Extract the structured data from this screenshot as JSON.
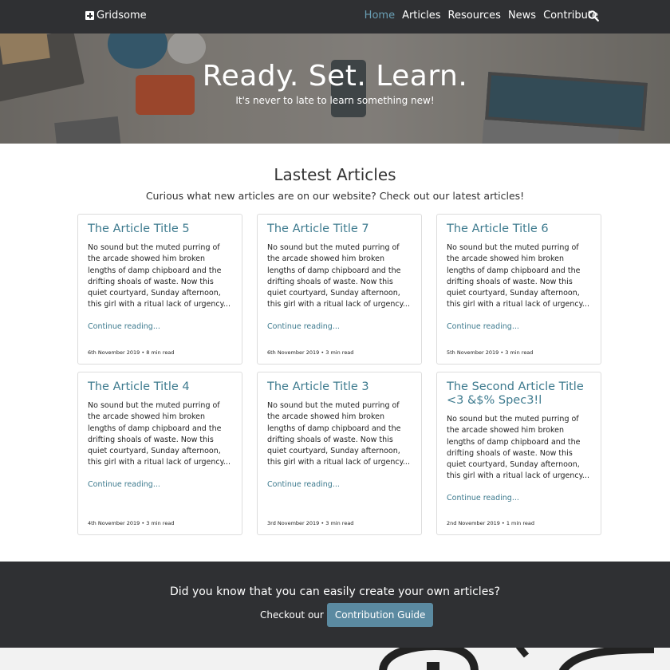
{
  "nav": {
    "brand": "Gridsome",
    "links": [
      "Home",
      "Articles",
      "Resources",
      "News",
      "Contribute"
    ]
  },
  "hero": {
    "title": "Ready. Set. Learn.",
    "subtitle": "It's never to late to learn something new!"
  },
  "articles": {
    "title": "Lastest Articles",
    "subtitle": "Curious what new articles are on our website? Check out our latest articles!",
    "cards": [
      {
        "title": "The Article Title 5",
        "excerpt": "No sound but the muted purring of the arcade showed him broken lengths of damp chipboard and the drifting shoals of waste. Now this quiet courtyard, Sunday afternoon, this girl with a ritual lack of urgency...",
        "link": "Continue reading...",
        "meta": "6th November 2019 • 8 min read"
      },
      {
        "title": "The Article Title 7",
        "excerpt": "No sound but the muted purring of the arcade showed him broken lengths of damp chipboard and the drifting shoals of waste. Now this quiet courtyard, Sunday afternoon, this girl with a ritual lack of urgency...",
        "link": "Continue reading...",
        "meta": "6th November 2019 • 3 min read"
      },
      {
        "title": "The Article Title 6",
        "excerpt": "No sound but the muted purring of the arcade showed him broken lengths of damp chipboard and the drifting shoals of waste. Now this quiet courtyard, Sunday afternoon, this girl with a ritual lack of urgency...",
        "link": "Continue reading...",
        "meta": "5th November 2019 • 3 min read"
      },
      {
        "title": "The Article Title 4",
        "excerpt": "No sound but the muted purring of the arcade showed him broken lengths of damp chipboard and the drifting shoals of waste. Now this quiet courtyard, Sunday afternoon, this girl with a ritual lack of urgency...",
        "link": "Continue reading...",
        "meta": "4th November 2019 • 3 min read"
      },
      {
        "title": "The Article Title 3",
        "excerpt": "No sound but the muted purring of the arcade showed him broken lengths of damp chipboard and the drifting shoals of waste. Now this quiet courtyard, Sunday afternoon, this girl with a ritual lack of urgency...",
        "link": "Continue reading...",
        "meta": "3rd November 2019 • 3 min read"
      },
      {
        "title": "The Second Article Title <3 &$% Spec3!l",
        "excerpt": "No sound but the muted purring of the arcade showed him broken lengths of damp chipboard and the drifting shoals of waste. Now this quiet courtyard, Sunday afternoon, this girl with a ritual lack of urgency...",
        "link": "Continue reading...",
        "meta": "2nd November 2019 • 1 min read"
      }
    ]
  },
  "cta": {
    "title": "Did you know that you can easily create your own articles?",
    "label": "Checkout our",
    "button": "Contribution Guide"
  },
  "icons": {
    "brand": "plus-square-icon",
    "search": "search-icon"
  },
  "colors": {
    "nav_bg": "#2f3033",
    "accent": "#3d7a8e",
    "active_link": "#6a9fb5",
    "button": "#5b8aa1"
  }
}
